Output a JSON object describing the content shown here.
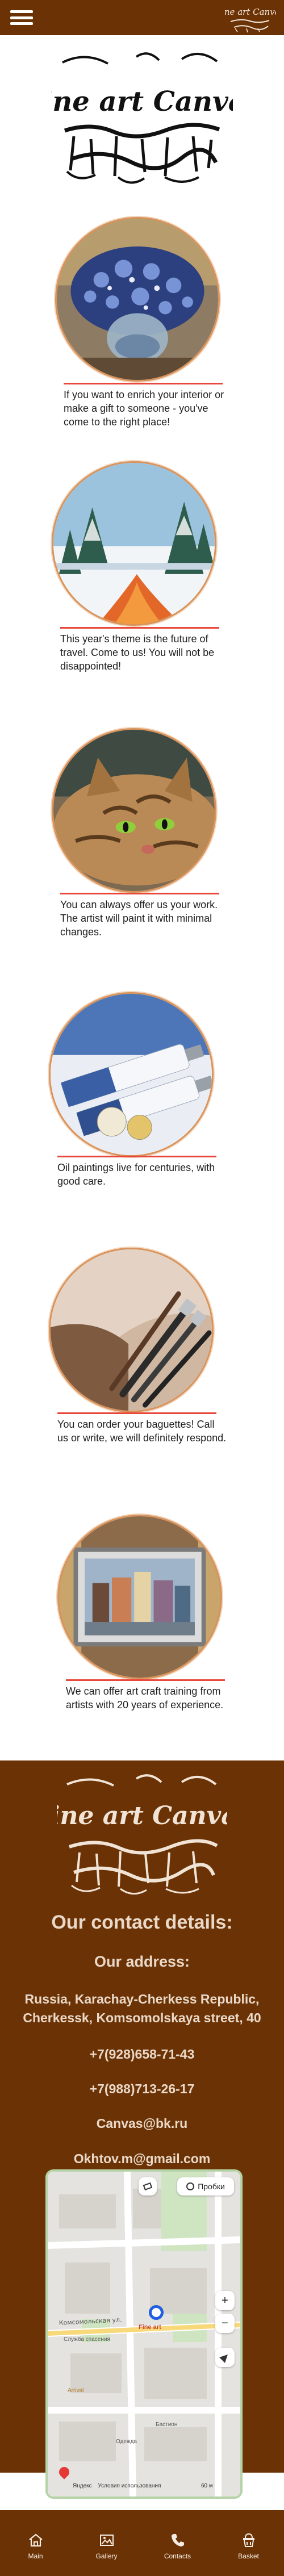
{
  "header": {
    "menu_icon": "hamburger-menu-icon",
    "brand_logo": "Fine art Canvas"
  },
  "hero": {
    "logo_text": "Fine art Canvas"
  },
  "features": [
    {
      "image": "painting-blue-flowers-in-vase",
      "caption": "If you want to enrich your interior or make a gift to someone - you've come to the right place!"
    },
    {
      "image": "painting-winter-forest-river",
      "caption": "This year's theme is the future of travel. Come to us! You will not be disappointed!"
    },
    {
      "image": "painting-tabby-cat",
      "caption": "You can always offer us your work. The artist will paint it with minimal changes."
    },
    {
      "image": "photo-oil-paint-tubes",
      "caption": "Oil paintings live for centuries, with good care."
    },
    {
      "image": "photo-paint-brushes",
      "caption": "You can order your baguettes! Call us or write, we will definitely respond."
    },
    {
      "image": "photo-framed-city-painting",
      "caption": "We can offer art craft training from artists with 20 years of experience."
    }
  ],
  "colors": {
    "brand_brown": "#6b3305",
    "accent_red": "#e8473c",
    "footer_text": "#ead9c9",
    "map_border": "#b6d3a8"
  },
  "footer": {
    "logo_text": "Fine art Canvas",
    "contact_title": "Our contact details:",
    "address_title": "Our address:",
    "address": "Russia, Karachay-Cherkess Republic, Cherkessk, Komsomolskaya street, 40",
    "phone_1": "+7(928)658-71-43",
    "phone_2": "+7(988)713-26-17",
    "email_1": "Canvas@bk.ru",
    "email_2": "Okhtov.m@gmail.com"
  },
  "map": {
    "traffic_button": "Пробки",
    "street_1": "Комсомольская ул.",
    "poi_1": "Служба спасения",
    "poi_2": "Arrival",
    "poi_3": "Одежда",
    "poi_4": "Бастион",
    "poi_5": "Fine art",
    "zoom_in": "+",
    "zoom_out": "−",
    "footer_logo": "Яндекс",
    "footer_terms": "Условия использования",
    "scale": "60 м"
  },
  "bottom_nav": [
    {
      "label": "Main",
      "icon": "home-icon"
    },
    {
      "label": "Gallery",
      "icon": "gallery-icon"
    },
    {
      "label": "Contacts",
      "icon": "phone-icon"
    },
    {
      "label": "Basket",
      "icon": "basket-icon"
    }
  ]
}
